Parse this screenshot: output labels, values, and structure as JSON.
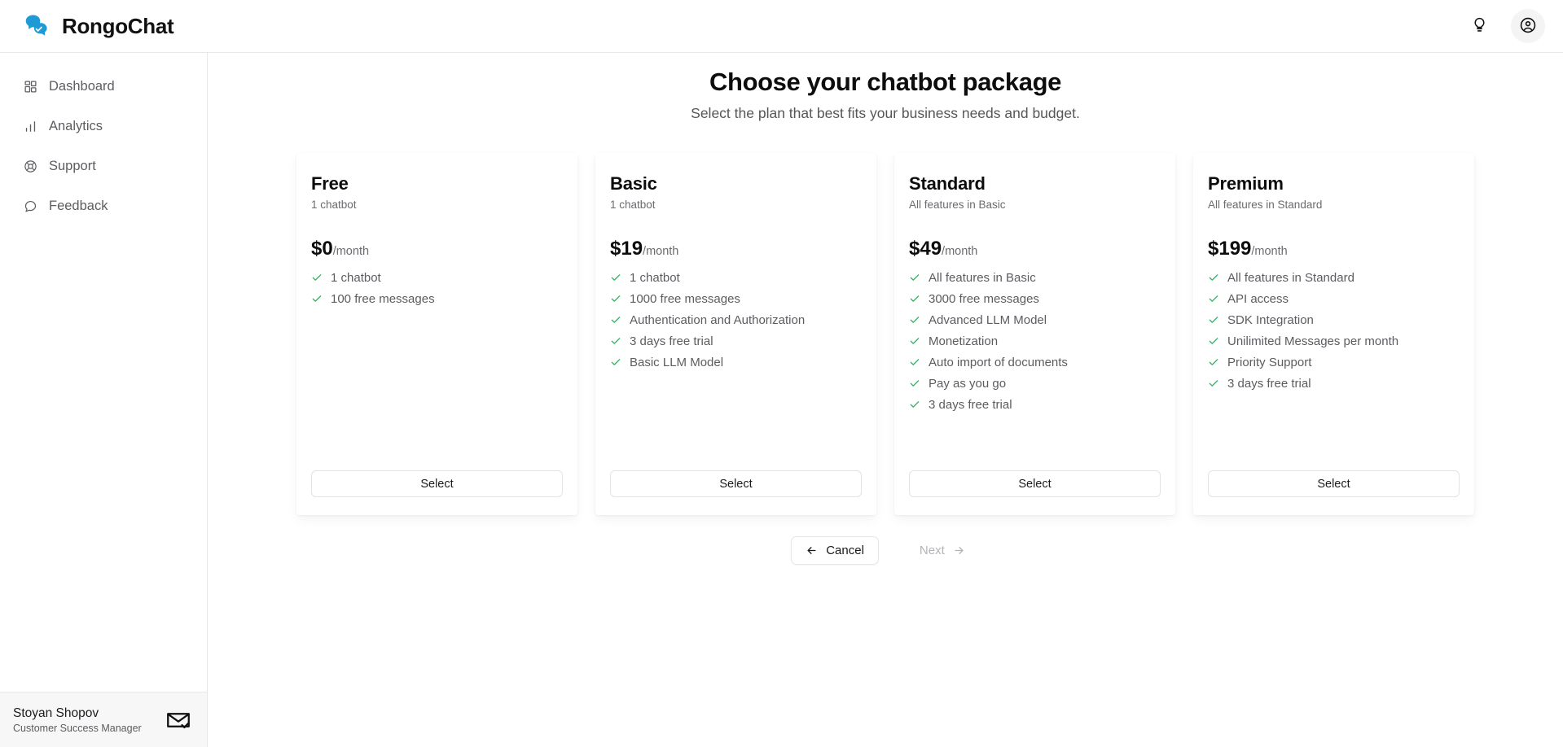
{
  "app": {
    "brand_name": "RongoChat",
    "brand_logo_icon": "chat-bubbles-logo"
  },
  "topbar": {
    "tips_icon": "lightbulb-icon",
    "account_icon": "user-circle-icon"
  },
  "sidebar": {
    "items": [
      {
        "label": "Dashboard",
        "icon": "grid-icon"
      },
      {
        "label": "Analytics",
        "icon": "bar-chart-icon"
      },
      {
        "label": "Support",
        "icon": "lifebuoy-icon"
      },
      {
        "label": "Feedback",
        "icon": "message-circle-icon"
      }
    ],
    "profile": {
      "name": "Stoyan Shopov",
      "role": "Customer Success Manager",
      "icon": "mail-check-icon"
    }
  },
  "main": {
    "title": "Choose your chatbot package",
    "subtitle": "Select the plan that best fits your business needs and budget.",
    "plans": [
      {
        "name": "Free",
        "subtitle": "1 chatbot",
        "price": "$0",
        "period": "/month",
        "features": [
          "1 chatbot",
          "100 free messages"
        ],
        "select_label": "Select"
      },
      {
        "name": "Basic",
        "subtitle": "1 chatbot",
        "price": "$19",
        "period": "/month",
        "features": [
          "1 chatbot",
          "1000 free messages",
          "Authentication and Authorization",
          "3 days free trial",
          "Basic LLM Model"
        ],
        "select_label": "Select"
      },
      {
        "name": "Standard",
        "subtitle": "All features in Basic",
        "price": "$49",
        "period": "/month",
        "features": [
          "All features in Basic",
          "3000 free messages",
          "Advanced LLM Model",
          "Monetization",
          "Auto import of documents",
          "Pay as you go",
          "3 days free trial"
        ],
        "select_label": "Select"
      },
      {
        "name": "Premium",
        "subtitle": "All features in Standard",
        "price": "$199",
        "period": "/month",
        "features": [
          "All features in Standard",
          "API access",
          "SDK Integration",
          "Unilimited Messages per month",
          "Priority Support",
          "3 days free trial"
        ],
        "select_label": "Select"
      }
    ],
    "wizard": {
      "cancel_label": "Cancel",
      "cancel_icon": "arrow-left-icon",
      "next_label": "Next",
      "next_icon": "arrow-right-icon",
      "next_disabled": true
    }
  },
  "colors": {
    "brand_blue": "#1e9ad6",
    "check_green": "#2bb35c",
    "text_primary": "#0d0d0d",
    "text_muted": "#6b6b70",
    "border": "#e8e8e8"
  }
}
